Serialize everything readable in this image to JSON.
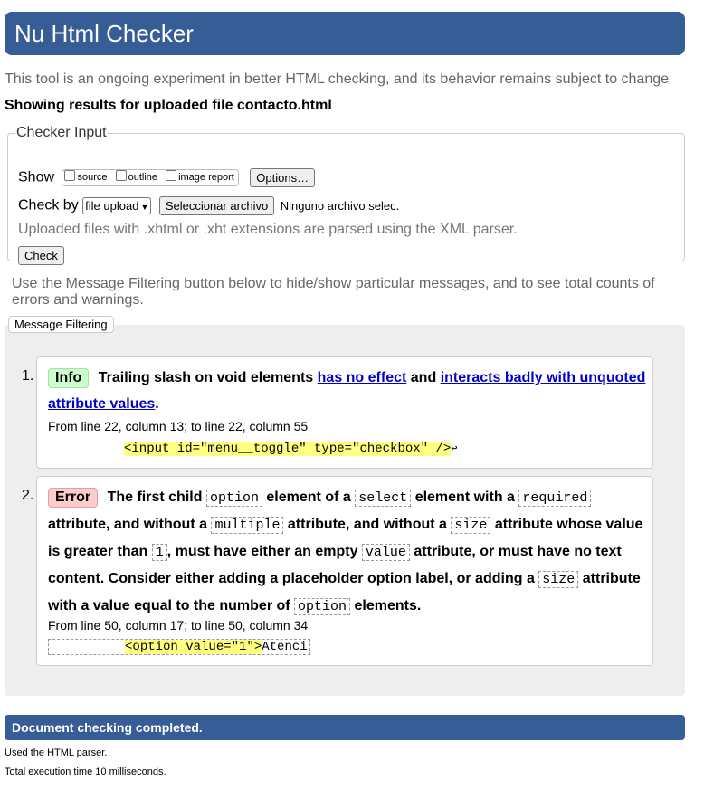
{
  "header": {
    "title": "Nu Html Checker"
  },
  "tagline": "This tool is an ongoing experiment in better HTML checking, and its behavior remains subject to change",
  "showing": "Showing results for uploaded file contacto.html",
  "checker_input": {
    "legend": "Checker Input",
    "show_label": "Show",
    "show_options": [
      "source",
      "outline",
      "image report"
    ],
    "options_button": "Options…",
    "check_by_label": "Check by",
    "check_by_value": "file upload",
    "file_button": "Seleccionar archivo",
    "file_status": "Ninguno archivo selec.",
    "note": "Uploaded files with .xhtml or .xht extensions are parsed using the XML parser.",
    "check_button": "Check"
  },
  "filter_note": "Use the Message Filtering button below to hide/show particular messages, and to see total counts of errors and warnings.",
  "filter_button": "Message Filtering",
  "messages": [
    {
      "number": "1.",
      "type": "Info",
      "text_a": "Trailing slash on void elements",
      "link1": "has no effect",
      "text_b": "and",
      "link2": "interacts badly with unquoted attribute values",
      "text_c": ".",
      "location": "From line 22, column 13; to line 22, column 55",
      "extract": "<input id=\"menu__toggle\" type=\"checkbox\" />",
      "extract_end": "↩"
    },
    {
      "number": "2.",
      "type": "Error",
      "parts": [
        "The first child",
        "option",
        "element of a",
        "select",
        "element with a",
        "required",
        "attribute, and without a",
        "multiple",
        "attribute, and without a",
        "size",
        "attribute whose value is greater than",
        "1",
        ", must have either an empty",
        "value",
        "attribute, or must have no text content. Consider either adding a placeholder option label, or adding a",
        "size",
        "attribute with a value equal to the number of",
        "option",
        "elements."
      ],
      "location": "From line 50, column 17; to line 50, column 34",
      "extract_pre": "          ",
      "extract": "<option value=\"1\">",
      "extract_post": "Atenci"
    }
  ],
  "done": "Document checking completed.",
  "footer": {
    "parser": "Used the HTML parser.",
    "time": "Total execution time 10 milliseconds."
  },
  "colors": {
    "header_bg": "#365d95",
    "info_badge": "#ccffcc",
    "error_badge": "#ffcccc",
    "highlight": "#ffff80",
    "link": "#0000cc"
  }
}
